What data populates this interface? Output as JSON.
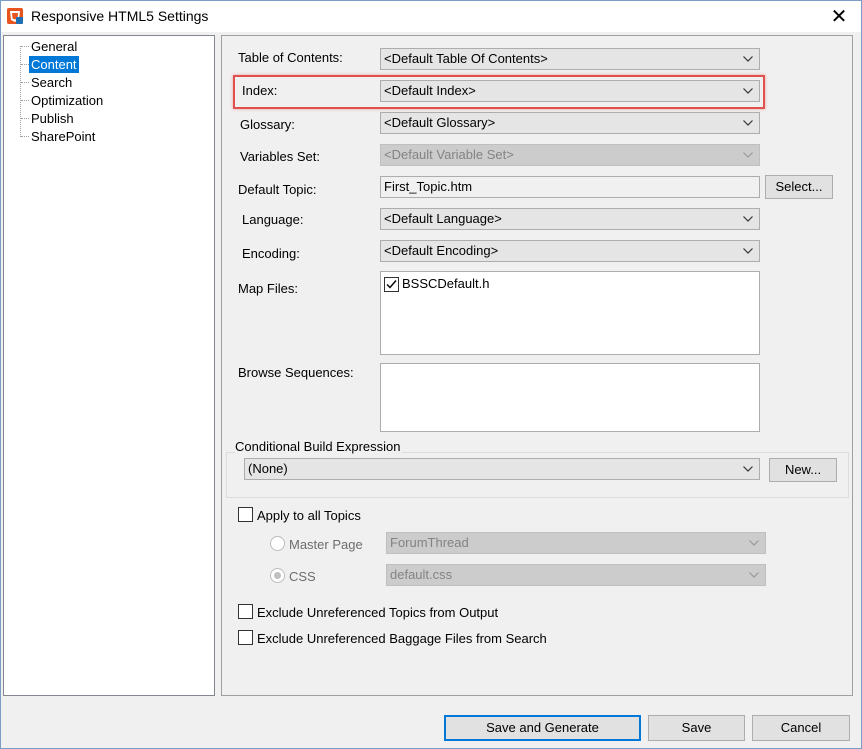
{
  "window": {
    "title": "Responsive HTML5 Settings",
    "close_glyph": "✕"
  },
  "sidebar": {
    "items": [
      {
        "label": "General"
      },
      {
        "label": "Content"
      },
      {
        "label": "Search"
      },
      {
        "label": "Optimization"
      },
      {
        "label": "Publish"
      },
      {
        "label": "SharePoint"
      }
    ],
    "selected": "Content"
  },
  "form": {
    "toc_label": "Table of Contents:",
    "toc_value": "<Default Table Of Contents>",
    "index_label": "Index:",
    "index_value": "<Default Index>",
    "glossary_label": "Glossary:",
    "glossary_value": "<Default Glossary>",
    "variables_label": "Variables Set:",
    "variables_value": "<Default Variable Set>",
    "default_topic_label": "Default Topic:",
    "default_topic_value": "First_Topic.htm",
    "select_button": "Select...",
    "language_label": "Language:",
    "language_value": "<Default Language>",
    "encoding_label": "Encoding:",
    "encoding_value": "<Default Encoding>",
    "map_files_label": "Map Files:",
    "map_files_items": [
      {
        "label": "BSSCDefault.h",
        "checked": true
      }
    ],
    "browse_sequences_label": "Browse Sequences:",
    "cbe_label": "Conditional Build Expression",
    "cbe_value": "(None)",
    "new_button": "New...",
    "apply_all_label": "Apply to all Topics",
    "master_page_label": "Master Page",
    "master_page_value": "ForumThread",
    "css_label": "CSS",
    "css_value": "default.css",
    "exclude_topics_label": "Exclude Unreferenced Topics from Output",
    "exclude_baggage_label": "Exclude Unreferenced Baggage Files from Search"
  },
  "footer": {
    "save_generate": "Save and Generate",
    "save": "Save",
    "cancel": "Cancel"
  },
  "colors": {
    "accent": "#0078d7",
    "highlight_border": "#e0514d",
    "app_icon": "#e8541e"
  }
}
